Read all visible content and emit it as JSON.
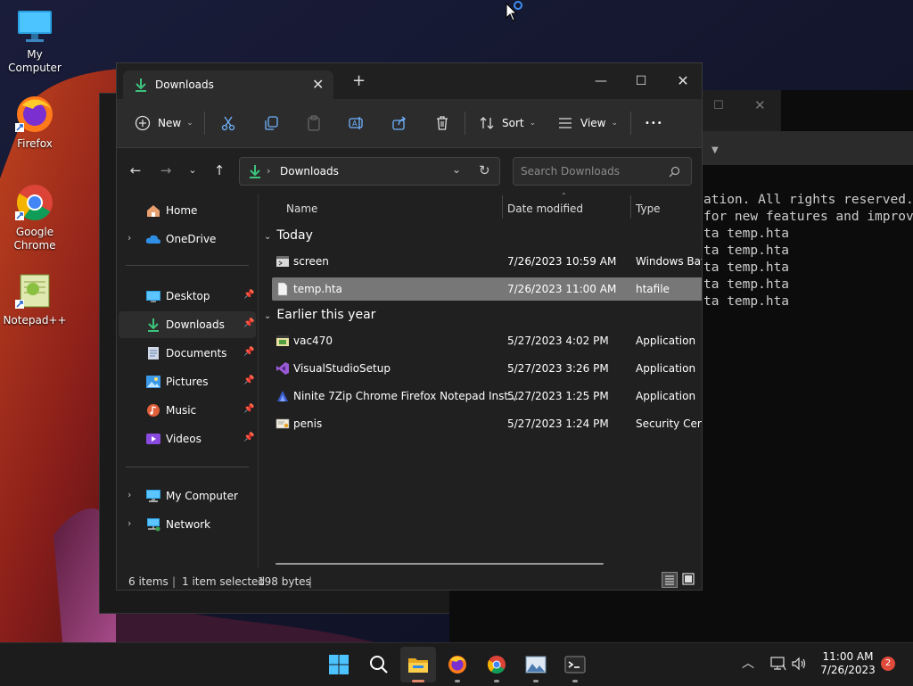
{
  "desktop": {
    "icons": [
      {
        "label": "My Computer"
      },
      {
        "label": "Firefox"
      },
      {
        "label": "Google Chrome"
      },
      {
        "label": "Notepad++"
      }
    ]
  },
  "terminal": {
    "lines": [
      "ation. All rights reserved.",
      "",
      "for new features and improv",
      "",
      "ta temp.hta",
      "ta temp.hta",
      "ta temp.hta",
      "ta temp.hta",
      "ta temp.hta"
    ]
  },
  "explorer": {
    "tab_title": "Downloads",
    "toolbar": {
      "new_label": "New",
      "sort_label": "Sort",
      "view_label": "View",
      "more_label": "•••"
    },
    "address": {
      "path": "Downloads",
      "search_placeholder": "Search Downloads"
    },
    "sidebar": {
      "items": [
        {
          "label": "Home",
          "icon": "home-icon"
        },
        {
          "label": "OneDrive",
          "icon": "cloud-icon"
        },
        {
          "label": "Desktop",
          "icon": "desktop-folder-icon"
        },
        {
          "label": "Downloads",
          "icon": "download-icon"
        },
        {
          "label": "Documents",
          "icon": "document-icon"
        },
        {
          "label": "Pictures",
          "icon": "pictures-icon"
        },
        {
          "label": "Music",
          "icon": "music-icon"
        },
        {
          "label": "Videos",
          "icon": "video-icon"
        },
        {
          "label": "My Computer",
          "icon": "computer-icon"
        },
        {
          "label": "Network",
          "icon": "network-icon"
        }
      ]
    },
    "columns": {
      "name": "Name",
      "date": "Date modified",
      "type": "Type"
    },
    "groups": [
      {
        "title": "Today",
        "files": [
          {
            "name": "screen",
            "date": "7/26/2023 10:59 AM",
            "type": "Windows Batc"
          },
          {
            "name": "temp.hta",
            "date": "7/26/2023 11:00 AM",
            "type": "htafile"
          }
        ]
      },
      {
        "title": "Earlier this year",
        "files": [
          {
            "name": "vac470",
            "date": "5/27/2023 4:02 PM",
            "type": "Application"
          },
          {
            "name": "VisualStudioSetup",
            "date": "5/27/2023 3:26 PM",
            "type": "Application"
          },
          {
            "name": "Ninite 7Zip Chrome Firefox Notepad Inst...",
            "date": "5/27/2023 1:25 PM",
            "type": "Application"
          },
          {
            "name": "penis",
            "date": "5/27/2023 1:24 PM",
            "type": "Security Certifi"
          }
        ]
      }
    ],
    "status": {
      "count": "6 items",
      "selected": "1 item selected",
      "size": "198 bytes"
    }
  },
  "taskbar": {
    "time": "11:00 AM",
    "date": "7/26/2023",
    "notifications": "2"
  },
  "colors": {
    "accent_folder": "#f5c04a",
    "download_green": "#3cc47c",
    "selection": "#777777",
    "explorer_bg": "#202020"
  }
}
